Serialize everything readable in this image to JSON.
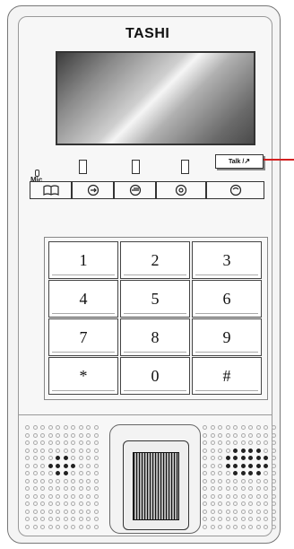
{
  "brand": "TASHI",
  "mic_label": "Mic",
  "talk_label": "Talk /",
  "function_buttons": [
    {
      "icon": "book-icon"
    },
    {
      "icon": "monitor-icon"
    },
    {
      "icon": "unlock-icon"
    },
    {
      "icon": "intercom-icon"
    },
    {
      "icon": "call-icon"
    }
  ],
  "keys": [
    "1",
    "2",
    "3",
    "4",
    "5",
    "6",
    "7",
    "8",
    "9",
    "*",
    "0",
    "#"
  ],
  "colors": {
    "indicator_line": "#d42020",
    "body": "#f4f4f4",
    "outline": "#333333"
  }
}
